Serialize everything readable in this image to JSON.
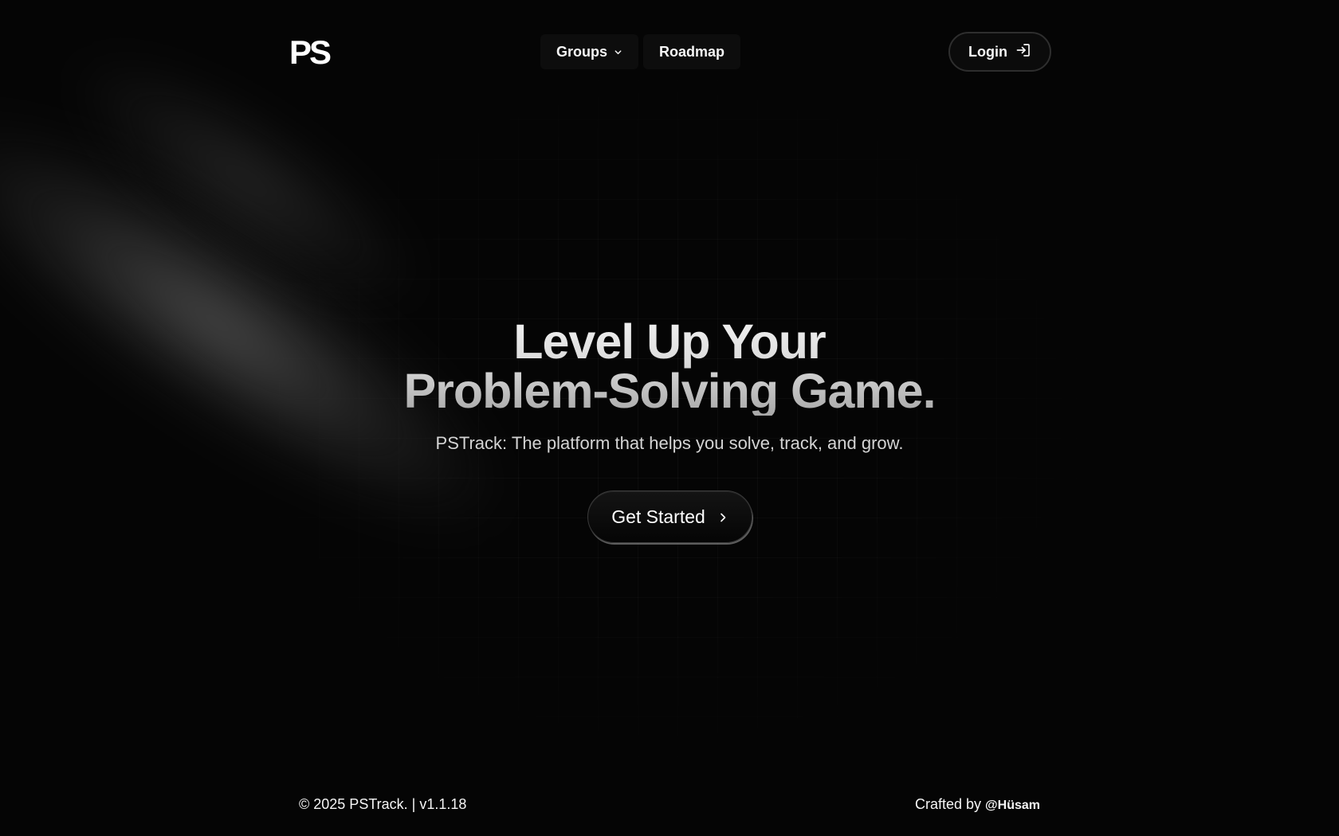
{
  "header": {
    "logo_text": "PS",
    "nav": {
      "groups_label": "Groups",
      "roadmap_label": "Roadmap"
    },
    "login_label": "Login"
  },
  "hero": {
    "headline_line1": "Level Up Your",
    "headline_line2": "Problem-Solving Game.",
    "subtitle": "PSTrack: The platform that helps you solve, track, and grow.",
    "cta_label": "Get Started"
  },
  "footer": {
    "copyright": "© 2025 PSTrack. | v1.1.18",
    "crafted_by": "Crafted by",
    "author": "@Hüsam"
  },
  "icons": {
    "groups_dropdown": "chevron-down-icon",
    "login": "login-arrow-icon",
    "cta": "chevron-right-icon"
  },
  "colors": {
    "background": "#050505",
    "text": "#f5f5f5",
    "button_border": "#2e2e2e"
  }
}
